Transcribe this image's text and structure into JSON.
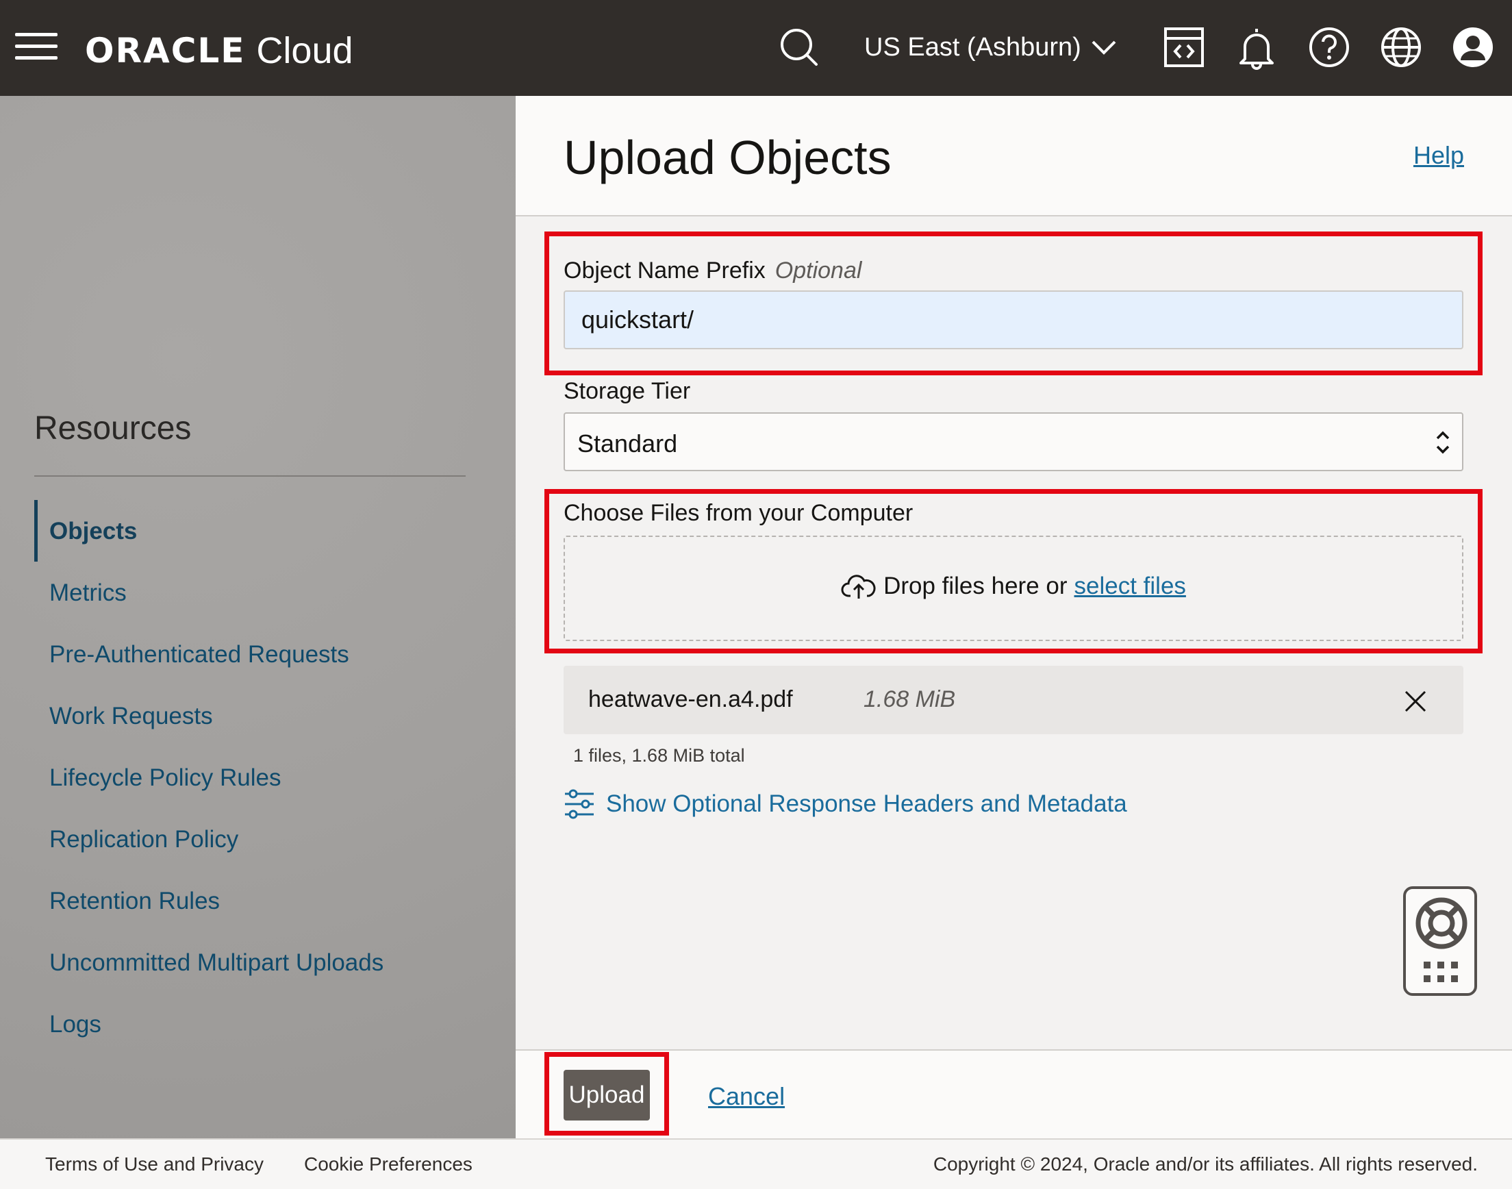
{
  "header": {
    "brand_oracle": "ORACLE",
    "brand_cloud": "Cloud",
    "region": "US East (Ashburn)"
  },
  "sidebar": {
    "title": "Resources",
    "items": [
      {
        "label": "Objects",
        "active": true
      },
      {
        "label": "Metrics"
      },
      {
        "label": "Pre-Authenticated Requests"
      },
      {
        "label": "Work Requests"
      },
      {
        "label": "Lifecycle Policy Rules"
      },
      {
        "label": "Replication Policy"
      },
      {
        "label": "Retention Rules"
      },
      {
        "label": "Uncommitted Multipart Uploads"
      },
      {
        "label": "Logs"
      }
    ]
  },
  "panel": {
    "title": "Upload Objects",
    "help": "Help",
    "prefix": {
      "label": "Object Name Prefix",
      "optional": "Optional",
      "value": "quickstart/"
    },
    "storage_tier": {
      "label": "Storage Tier",
      "value": "Standard"
    },
    "files": {
      "label": "Choose Files from your Computer",
      "drop_text": "Drop files here or",
      "select_link": "select files",
      "list": [
        {
          "name": "heatwave-en.a4.pdf",
          "size": "1.68 MiB"
        }
      ],
      "total": "1 files, 1.68 MiB total"
    },
    "optional_link": "Show Optional Response Headers and Metadata",
    "upload": "Upload",
    "cancel": "Cancel"
  },
  "footer": {
    "terms": "Terms of Use and Privacy",
    "cookies": "Cookie Preferences",
    "copyright": "Copyright © 2024, Oracle and/or its affiliates. All rights reserved."
  },
  "colors": {
    "highlight": "#e30613",
    "link": "#1a6c9c",
    "header_bg": "#312d2a"
  }
}
